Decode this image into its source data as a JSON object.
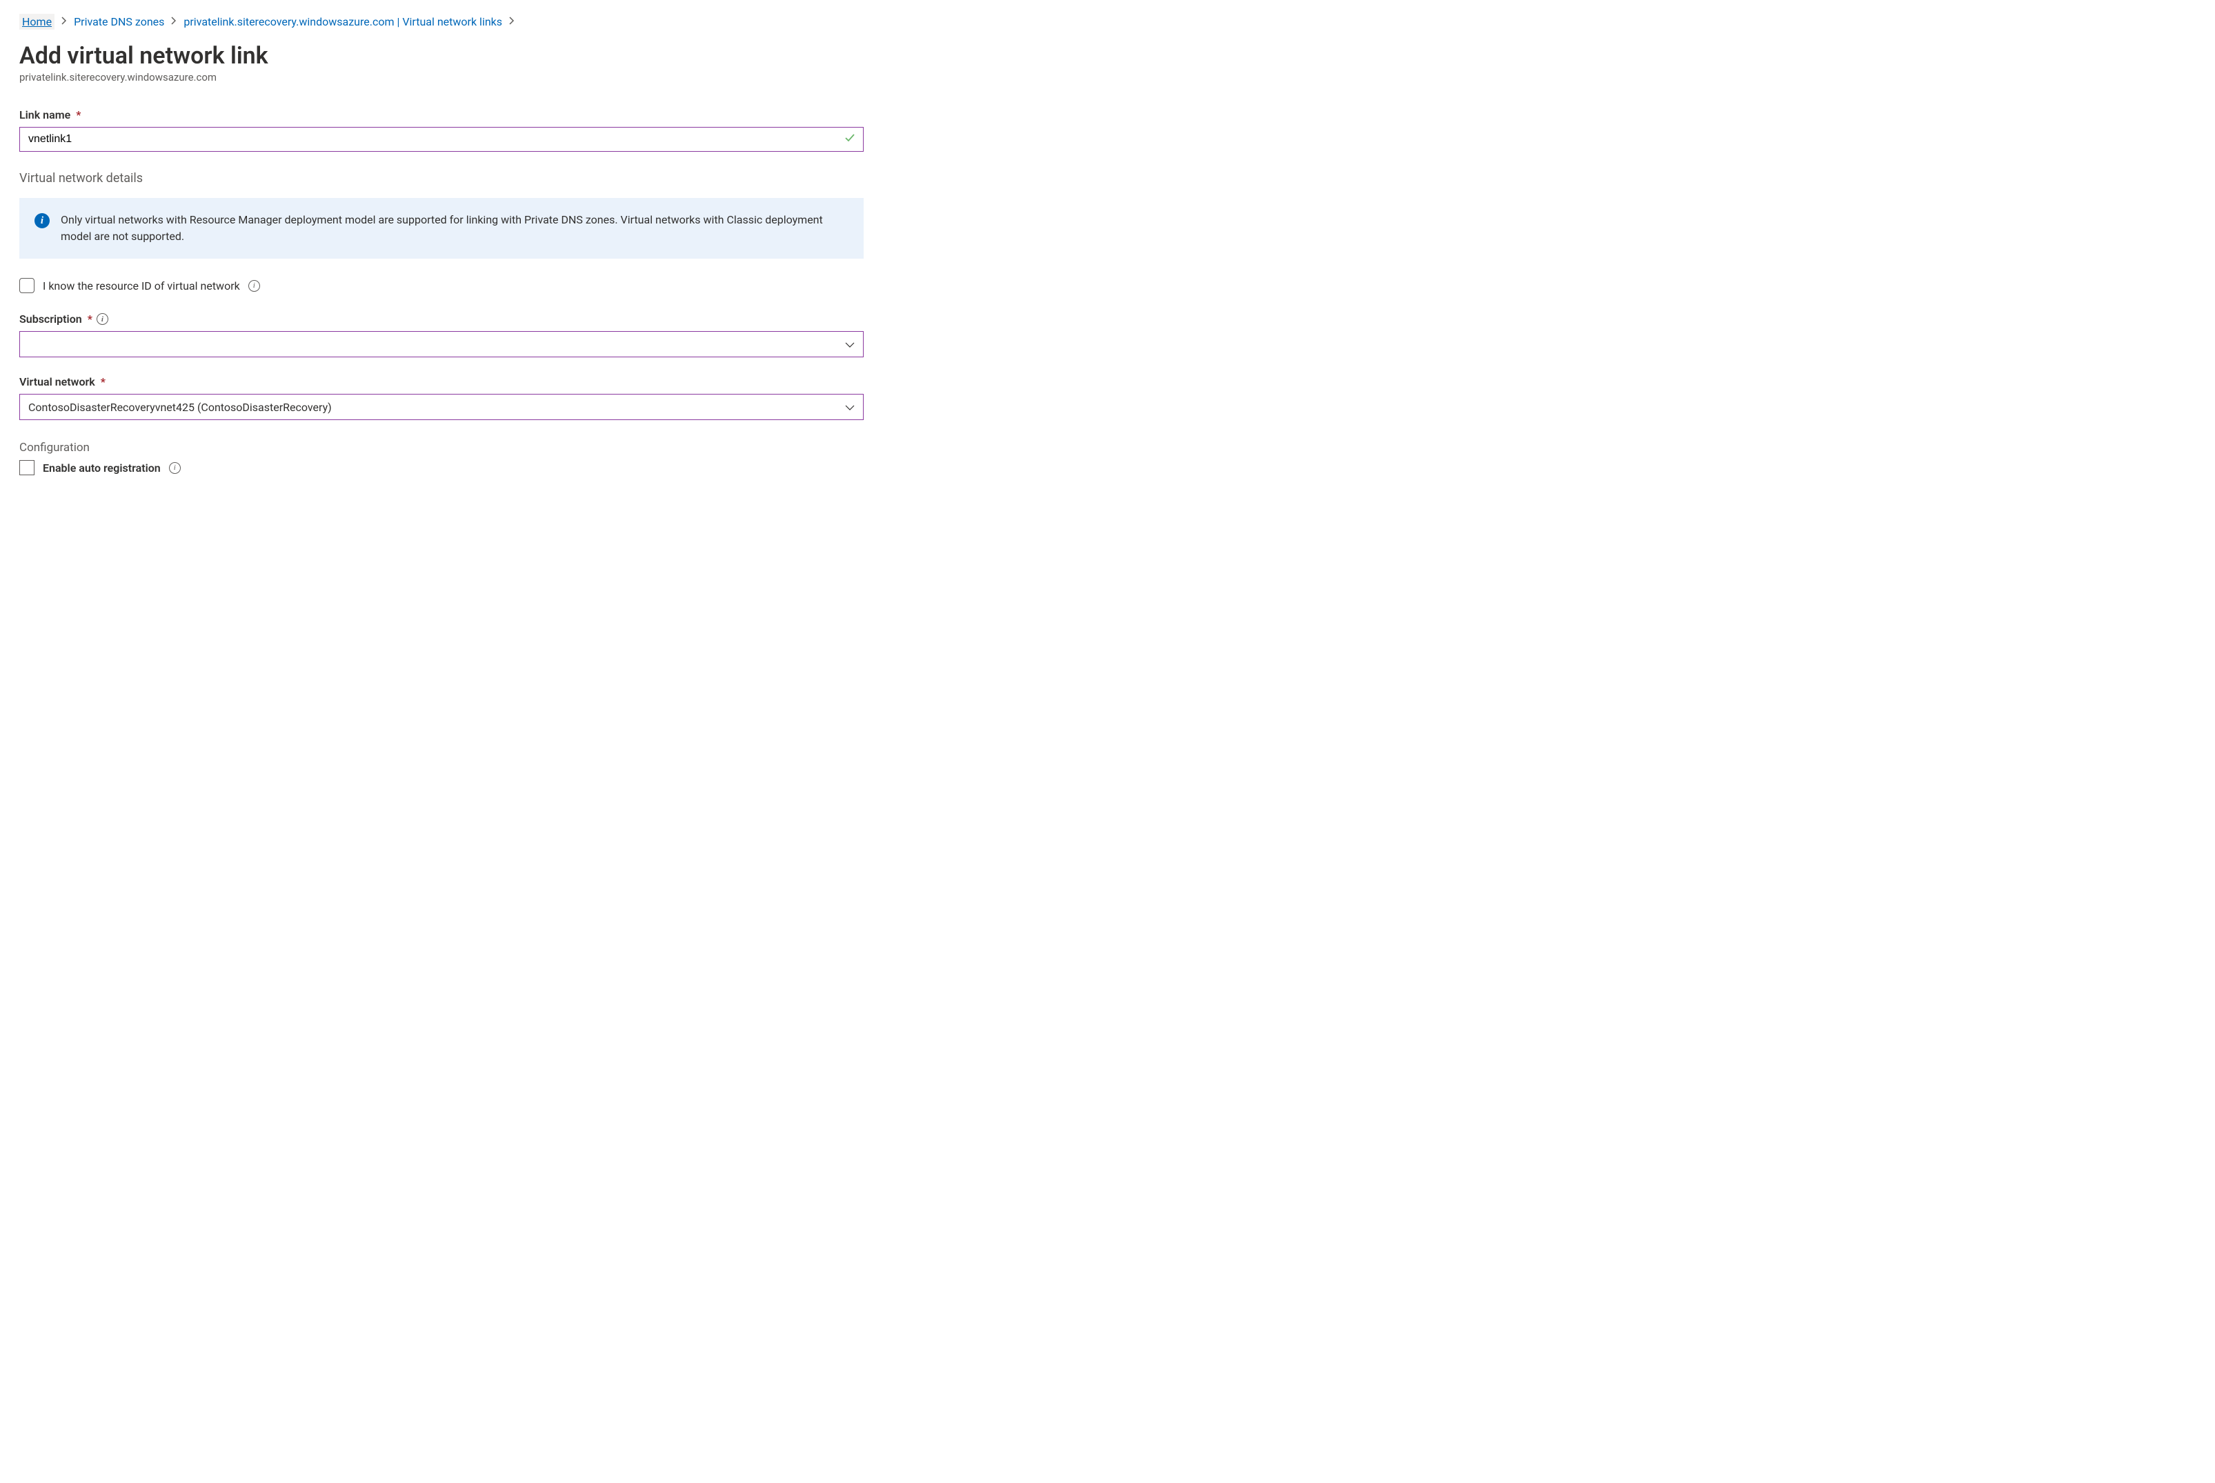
{
  "breadcrumb": {
    "home": "Home",
    "zones": "Private DNS zones",
    "zone_detail": "privatelink.siterecovery.windowsazure.com | Virtual network links"
  },
  "header": {
    "title": "Add virtual network link",
    "subtitle": "privatelink.siterecovery.windowsazure.com"
  },
  "link_name": {
    "label": "Link name",
    "value": "vnetlink1"
  },
  "vnet_details": {
    "section_title": "Virtual network details",
    "info_text": "Only virtual networks with Resource Manager deployment model are supported for linking with Private DNS zones. Virtual networks with Classic deployment model are not supported."
  },
  "resource_id_checkbox": {
    "label": "I know the resource ID of virtual network",
    "checked": false
  },
  "subscription": {
    "label": "Subscription",
    "value": ""
  },
  "virtual_network": {
    "label": "Virtual network",
    "value": "ContosoDisasterRecoveryvnet425 (ContosoDisasterRecovery)"
  },
  "configuration": {
    "section_title": "Configuration",
    "auto_registration_label": "Enable auto registration",
    "auto_registration_checked": false
  }
}
